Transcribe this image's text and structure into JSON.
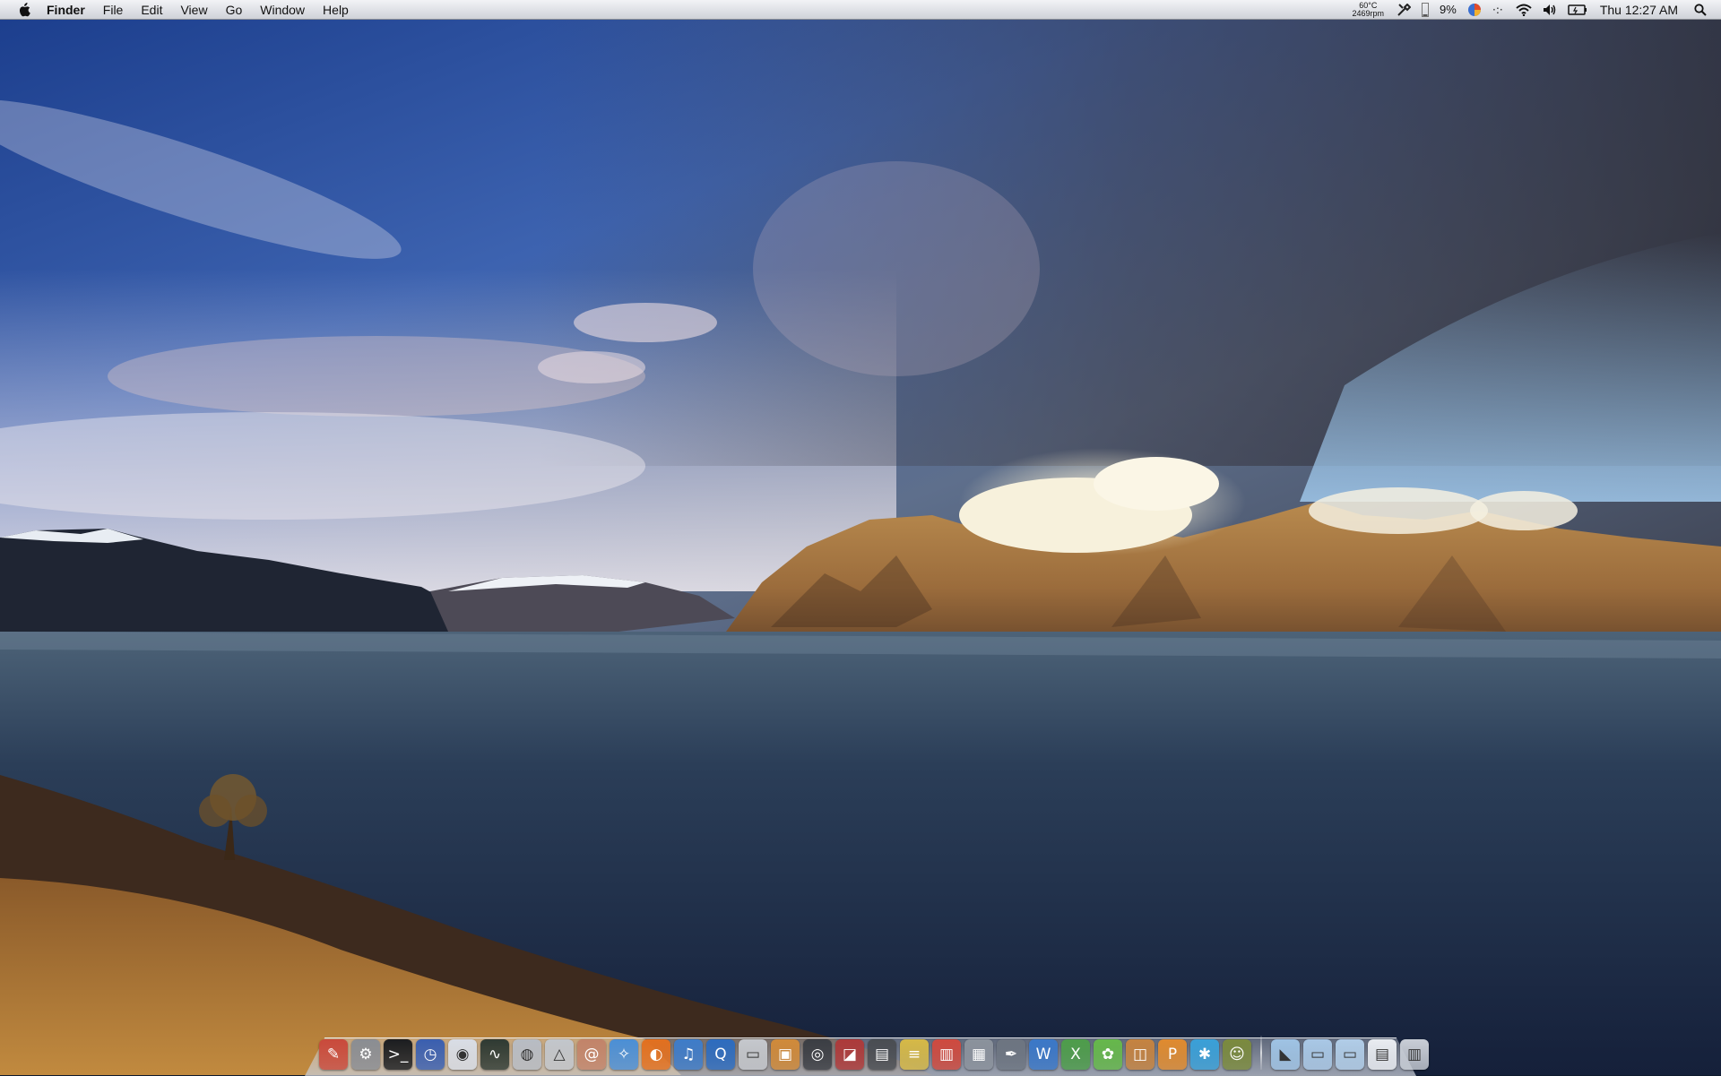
{
  "menubar": {
    "apple_icon": "apple-logo-icon",
    "app_name": "Finder",
    "items": [
      "File",
      "Edit",
      "View",
      "Go",
      "Window",
      "Help"
    ],
    "status": {
      "temperature": "60°C",
      "fan_speed": "2469rpm",
      "cpu_percent": "9%",
      "clock": "Thu 12:27 AM"
    }
  },
  "dock": {
    "apps": [
      {
        "name": "finder-icon",
        "color": "#c94a3c",
        "glyph": "✎"
      },
      {
        "name": "system-preferences-icon",
        "color": "#8a8d93",
        "glyph": "⚙"
      },
      {
        "name": "terminal-icon",
        "color": "#1b1d20",
        "glyph": ">_"
      },
      {
        "name": "time-machine-icon",
        "color": "#3a5fb0",
        "glyph": "◷"
      },
      {
        "name": "wifi-scanner-icon",
        "color": "#d8dde6",
        "glyph": "◉"
      },
      {
        "name": "activity-monitor-icon",
        "color": "#2f3a33",
        "glyph": "∿"
      },
      {
        "name": "disk-utility-icon",
        "color": "#b7bcc4",
        "glyph": "◍"
      },
      {
        "name": "grapher-icon",
        "color": "#c2c6cc",
        "glyph": "△"
      },
      {
        "name": "address-book-icon",
        "color": "#c2846a",
        "glyph": "@"
      },
      {
        "name": "safari-icon",
        "color": "#4b8fd6",
        "glyph": "✧"
      },
      {
        "name": "firefox-icon",
        "color": "#e2701f",
        "glyph": "◐"
      },
      {
        "name": "itunes-icon",
        "color": "#3e7cc9",
        "glyph": "♫"
      },
      {
        "name": "quicktime-icon",
        "color": "#2d6cbf",
        "glyph": "Q"
      },
      {
        "name": "dvd-player-icon",
        "color": "#c5c8cd",
        "glyph": "▭"
      },
      {
        "name": "iphoto-icon",
        "color": "#d08a3a",
        "glyph": "▣"
      },
      {
        "name": "camera-icon",
        "color": "#3b3e44",
        "glyph": "◎"
      },
      {
        "name": "photo-booth-icon",
        "color": "#ad3a3a",
        "glyph": "◪"
      },
      {
        "name": "utility-icon",
        "color": "#4a4d52",
        "glyph": "▤"
      },
      {
        "name": "notes-icon",
        "color": "#d6b947",
        "glyph": "≡"
      },
      {
        "name": "parallels-icon",
        "color": "#cf4a3f",
        "glyph": "▥"
      },
      {
        "name": "dashboard-icon",
        "color": "#8b929c",
        "glyph": "▦"
      },
      {
        "name": "script-editor-icon",
        "color": "#6d7581",
        "glyph": "✒"
      },
      {
        "name": "word-icon",
        "color": "#3b78c8",
        "glyph": "W"
      },
      {
        "name": "excel-icon",
        "color": "#4e9d4b",
        "glyph": "X"
      },
      {
        "name": "messenger-icon",
        "color": "#66b84b",
        "glyph": "✿"
      },
      {
        "name": "keynote-icon",
        "color": "#c58340",
        "glyph": "◫"
      },
      {
        "name": "powerpoint-icon",
        "color": "#e08b2f",
        "glyph": "P"
      },
      {
        "name": "network-icon",
        "color": "#3aa0d8",
        "glyph": "✱"
      },
      {
        "name": "automator-icon",
        "color": "#7b8a3e",
        "glyph": "☺"
      }
    ],
    "stacks": [
      {
        "name": "applications-folder-icon",
        "color": "#9fc3e4",
        "glyph": "◣"
      },
      {
        "name": "documents-folder-icon",
        "color": "#a9c8e6",
        "glyph": "▭"
      },
      {
        "name": "downloads-folder-icon",
        "color": "#b1cde8",
        "glyph": "▭"
      },
      {
        "name": "screen-capture-icon",
        "color": "#e9ecf1",
        "glyph": "▤"
      },
      {
        "name": "trash-icon",
        "color": "#c9ced6",
        "glyph": "▥"
      }
    ]
  }
}
